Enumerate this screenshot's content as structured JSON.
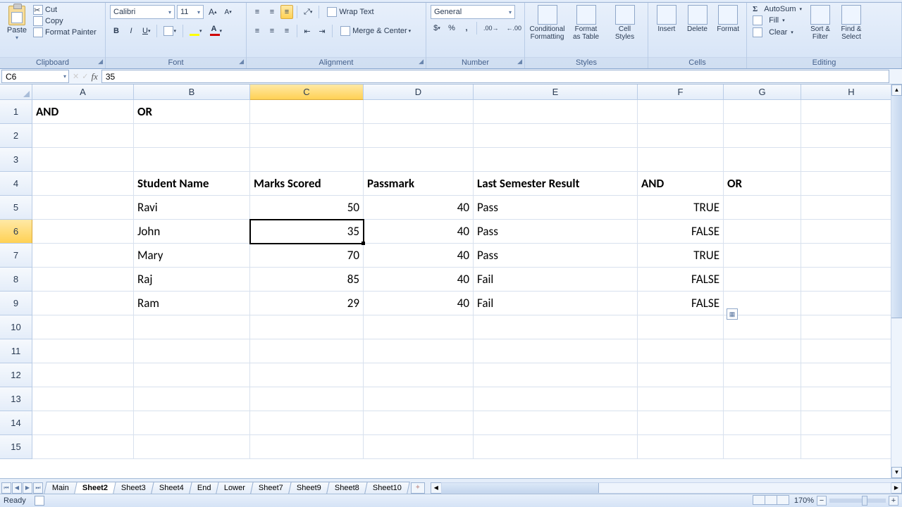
{
  "ribbon": {
    "clipboard": {
      "title": "Clipboard",
      "paste": "Paste",
      "cut": "Cut",
      "copy": "Copy",
      "format_painter": "Format Painter"
    },
    "font": {
      "title": "Font",
      "name": "Calibri",
      "size": "11"
    },
    "alignment": {
      "title": "Alignment",
      "wrap": "Wrap Text",
      "merge": "Merge & Center"
    },
    "number": {
      "title": "Number",
      "format": "General"
    },
    "styles": {
      "title": "Styles",
      "cond": "Conditional\nFormatting",
      "as_table": "Format\nas Table",
      "cell": "Cell\nStyles"
    },
    "cells": {
      "title": "Cells",
      "insert": "Insert",
      "delete": "Delete",
      "format": "Format"
    },
    "editing": {
      "title": "Editing",
      "sum": "AutoSum",
      "fill": "Fill",
      "clear": "Clear",
      "sort": "Sort &\nFilter",
      "find": "Find &\nSelect"
    }
  },
  "namebox": "C6",
  "formula": "35",
  "columns": [
    "A",
    "B",
    "C",
    "D",
    "E",
    "F",
    "G",
    "H"
  ],
  "col_widths": [
    "cA",
    "cB",
    "cC",
    "cD",
    "cE",
    "cF",
    "cG",
    "cH"
  ],
  "selected_col": "C",
  "selected_row": 6,
  "selected_cell": "C6",
  "rows": [
    {
      "n": 1,
      "cells": {
        "A": {
          "v": "AND",
          "b": true
        },
        "B": {
          "v": "OR",
          "b": true
        }
      }
    },
    {
      "n": 2,
      "cells": {}
    },
    {
      "n": 3,
      "cells": {}
    },
    {
      "n": 4,
      "cells": {
        "B": {
          "v": "Student Name",
          "b": true
        },
        "C": {
          "v": "Marks Scored",
          "b": true
        },
        "D": {
          "v": "Passmark",
          "b": true
        },
        "E": {
          "v": "Last Semester Result",
          "b": true
        },
        "F": {
          "v": "AND",
          "b": true
        },
        "G": {
          "v": "OR",
          "b": true
        }
      }
    },
    {
      "n": 5,
      "cells": {
        "B": {
          "v": "Ravi"
        },
        "C": {
          "v": "50",
          "r": true
        },
        "D": {
          "v": "40",
          "r": true
        },
        "E": {
          "v": "Pass"
        },
        "F": {
          "v": "TRUE",
          "r": true
        }
      }
    },
    {
      "n": 6,
      "cells": {
        "B": {
          "v": "John"
        },
        "C": {
          "v": "35",
          "r": true
        },
        "D": {
          "v": "40",
          "r": true
        },
        "E": {
          "v": "Pass"
        },
        "F": {
          "v": "FALSE",
          "r": true
        }
      }
    },
    {
      "n": 7,
      "cells": {
        "B": {
          "v": "Mary"
        },
        "C": {
          "v": "70",
          "r": true
        },
        "D": {
          "v": "40",
          "r": true
        },
        "E": {
          "v": "Pass"
        },
        "F": {
          "v": "TRUE",
          "r": true
        }
      }
    },
    {
      "n": 8,
      "cells": {
        "B": {
          "v": "Raj"
        },
        "C": {
          "v": "85",
          "r": true
        },
        "D": {
          "v": "40",
          "r": true
        },
        "E": {
          "v": "Fail"
        },
        "F": {
          "v": "FALSE",
          "r": true
        }
      }
    },
    {
      "n": 9,
      "cells": {
        "B": {
          "v": "Ram"
        },
        "C": {
          "v": "29",
          "r": true
        },
        "D": {
          "v": "40",
          "r": true
        },
        "E": {
          "v": "Fail"
        },
        "F": {
          "v": "FALSE",
          "r": true
        }
      }
    },
    {
      "n": 10,
      "cells": {}
    },
    {
      "n": 11,
      "cells": {}
    },
    {
      "n": 12,
      "cells": {}
    },
    {
      "n": 13,
      "cells": {}
    },
    {
      "n": 14,
      "cells": {}
    },
    {
      "n": 15,
      "cells": {}
    }
  ],
  "fill_options_pos": {
    "row": 10,
    "col": "G"
  },
  "sheets": {
    "tabs": [
      "Main",
      "Sheet2",
      "Sheet3",
      "Sheet4",
      "End",
      "Lower",
      "Sheet7",
      "Sheet9",
      "Sheet8",
      "Sheet10"
    ],
    "active": "Sheet2"
  },
  "status": {
    "text": "Ready",
    "zoom": "170%"
  }
}
